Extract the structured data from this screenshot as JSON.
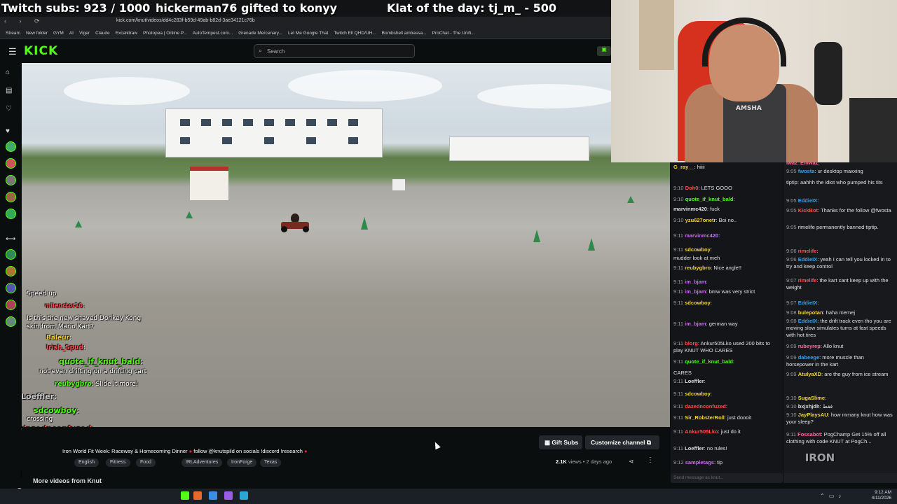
{
  "banner": {
    "subs": "Twitch subs: 923 / 1000",
    "gift": "hickerman76 gifted to konyy",
    "klat": "Klat of the day: tj_m_ - 500"
  },
  "browser": {
    "url": "kick.com/knut/videos/dd4c283f-b59d-49ab-b82d-3ae34121c76b",
    "bookmarks": [
      "Stream",
      "New folder",
      "GYM",
      "AI",
      "Viger",
      "Claude",
      "Excalidraw",
      "Photopea | Online P...",
      "AutoTempest.com...",
      "Grenade Mercenary...",
      "Let Me Google That",
      "Twitch Ell QHD/UH...",
      "Bombshell ambassa...",
      "ProChat - The Unifi..."
    ]
  },
  "kick": {
    "logo": "KICK",
    "search_placeholder": "Search"
  },
  "video_overlay_chat": [
    {
      "name": "",
      "text": "Speed up"
    },
    {
      "name": "mllenctor10",
      "text": ":"
    },
    {
      "name": "",
      "text": "Is this the new shaved Donkey Kong"
    },
    {
      "name": "",
      "text": "skin from Mario Kart?"
    },
    {
      "name": "Baleur",
      "text": ":"
    },
    {
      "name": "Irish_Spud",
      "text": ":"
    },
    {
      "name": "quote_if_knut_bald",
      "text": ":"
    },
    {
      "name": "",
      "text": "not even drifting on a drifting cart"
    },
    {
      "name": "reubygbro",
      "text": ": Slide it more!"
    },
    {
      "name": "Loeffler",
      "text": ":"
    },
    {
      "name": "sdcowboy",
      "text": ":"
    },
    {
      "name": "",
      "text": "crossing"
    },
    {
      "name": "dazednconfuzed",
      "text": ":"
    },
    {
      "name": "Sir_RobsterRoll",
      "text": ": just doooit"
    },
    {
      "name": "Ankur505Lko",
      "text": ": just do it"
    },
    {
      "name": "Loeffler",
      "text": ": no rules!"
    },
    {
      "name": "sampletags",
      "text": ""
    },
    {
      "name": "",
      "text": "/knutspild"
    }
  ],
  "video_info": {
    "gift_subs": "Gift Subs",
    "customize": "Customize channel",
    "title": "Iron World Fit Week: Raceway & Homecoming Dinner",
    "follow": "follow @knutspild on socials !discord !research",
    "views": "2.1K",
    "views_label": "views",
    "age": "2 days ago",
    "tags": [
      "English",
      "Fitness",
      "Food",
      "IRLAdventures",
      "IronForge",
      "Texas"
    ],
    "more_videos": "More videos from Knut"
  },
  "cam": {
    "shirt_text": "AMSHA"
  },
  "chat_left": [
    {
      "time": "",
      "name": "G_ray__",
      "text": ": hiiii"
    },
    {
      "time": "9:10",
      "name": "Doh0",
      "text": ": LETS GOOO"
    },
    {
      "time": "9:10",
      "name": "quote_if_knut_bald",
      "text": ":"
    },
    {
      "time": "",
      "name": "marvinmc420",
      "text": ": fuck"
    },
    {
      "time": "9:10",
      "name": "yzu627onetr",
      "text": ": Boi no.."
    },
    {
      "time": "9:11",
      "name": "marvinmc420",
      "text": ":"
    },
    {
      "time": "9:11",
      "name": "sdcowboy",
      "text": ":"
    },
    {
      "time": "",
      "name": "",
      "text": "mudder look at meh"
    },
    {
      "time": "9:11",
      "name": "reubygbro",
      "text": ": Nice angle!!"
    },
    {
      "time": "9:11",
      "name": "im_bjam",
      "text": ":"
    },
    {
      "time": "9:11",
      "name": "im_bjam",
      "text": ": bmw was very strict"
    },
    {
      "time": "9:11",
      "name": "sdcowboy",
      "text": ":"
    },
    {
      "time": "9:11",
      "name": "im_bjam",
      "text": ": german way"
    },
    {
      "time": "9:11",
      "name": "blorg",
      "text": ": Ankur505Lko used 200 bits to play KNUT WHO CARES"
    },
    {
      "time": "9:11",
      "name": "quote_if_knut_bald",
      "text": ":"
    },
    {
      "time": "",
      "name": "",
      "text": "CARES"
    },
    {
      "time": "9:11",
      "name": "Loeffler",
      "text": ":"
    },
    {
      "time": "9:11",
      "name": "sdcowboy",
      "text": ":"
    },
    {
      "time": "9:11",
      "name": "dazednconfuzed",
      "text": ":"
    },
    {
      "time": "9:11",
      "name": "Sir_RobsterRoll",
      "text": ": just doooit"
    },
    {
      "time": "9:11",
      "name": "Ankur505Lko",
      "text": ": just do it"
    },
    {
      "time": "9:11",
      "name": "Loeffler",
      "text": ": no rules!"
    },
    {
      "time": "9:12",
      "name": "sampletags",
      "text": ": tip"
    }
  ],
  "chat_right": [
    {
      "time": "",
      "name": "Iwaz_Elhwaz",
      "text": ":"
    },
    {
      "time": "9:05",
      "name": "fwosta",
      "text": ": ur desktop maxxing"
    },
    {
      "time": "",
      "name": "",
      "text": "tiptip: aahhh the idiot who pumped his tits"
    },
    {
      "time": "9:05",
      "name": "EddieIX",
      "text": ":"
    },
    {
      "time": "9:05",
      "name": "KickBot",
      "text": ": Thanks for the follow @fwosta"
    },
    {
      "time": "9:05",
      "name": "",
      "text": "rimelife permanently banned tiptip."
    },
    {
      "time": "9:06",
      "name": "rimelife",
      "text": ":"
    },
    {
      "time": "9:06",
      "name": "EddieIX",
      "text": ": yeah I can tell you locked in to try and keep control"
    },
    {
      "time": "9:07",
      "name": "rimelife",
      "text": ": the kart cant keep up with the weight"
    },
    {
      "time": "9:07",
      "name": "EddieIX",
      "text": ":"
    },
    {
      "time": "9:08",
      "name": "bulepotan",
      "text": ": haha memej"
    },
    {
      "time": "9:08",
      "name": "EddieIX",
      "text": ": the drift track even tho you are moving slow simulates turns at fast speeds with hot tires"
    },
    {
      "time": "9:09",
      "name": "rubeyrep",
      "text": ": Allo knut"
    },
    {
      "time": "9:09",
      "name": "dabeege",
      "text": ": more muscle than horsepower in the kart"
    },
    {
      "time": "9:09",
      "name": "AtulyaXD",
      "text": ": are the guy from ice stream"
    },
    {
      "time": "9:10",
      "name": "SugaSlime",
      "text": ":"
    },
    {
      "time": "9:10",
      "name": "bxjxhjdh",
      "text": ": فقط"
    },
    {
      "time": "9:10",
      "name": "JayPlaysAU",
      "text": ": how mmany knut how was your sleep?"
    },
    {
      "time": "9:11",
      "name": "Fossabot",
      "text": ": PogChamp Get 15% off all clothing with code KNUT at PogCh..."
    }
  ],
  "chat_input_placeholder": "Send message as knut...",
  "overlay_logo": "IRON",
  "clock": {
    "time": "9:12 AM",
    "date": "4/11/2026"
  },
  "colors": {
    "kick_green": "#53fc18",
    "name_purple": "#c76cf0",
    "name_yellow": "#f0d43a",
    "name_red": "#ff4d4d",
    "name_green": "#53fc18"
  }
}
